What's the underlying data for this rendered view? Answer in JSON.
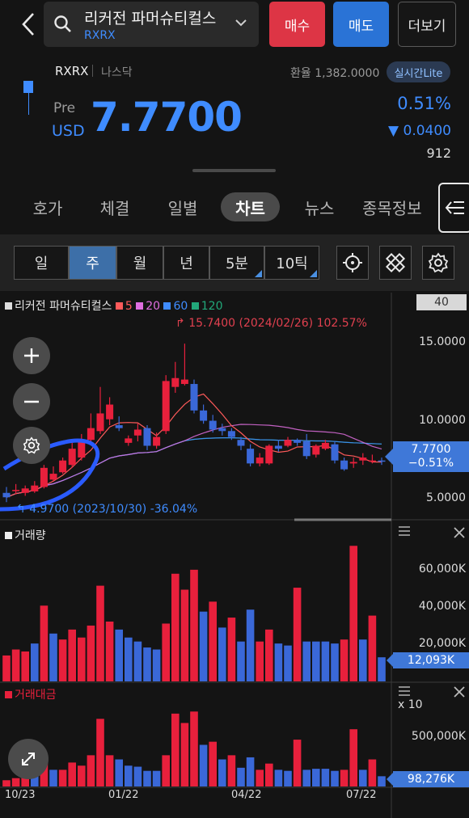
{
  "header": {
    "stock_name": "리커전 파머슈티컬스",
    "ticker": "RXRX",
    "buy_label": "매수",
    "sell_label": "매도",
    "more_label": "더보기"
  },
  "info": {
    "ticker": "RXRX",
    "market": "나스닥",
    "exchange_rate": "환율 1,382.0000",
    "realtime_label": "실시간Lite",
    "pre_label": "Pre",
    "currency": "USD",
    "price": "7.7700",
    "change_pct": "0.51%",
    "change_amount": "▼ 0.0400",
    "volume": "912"
  },
  "tabs": [
    {
      "label": "호가"
    },
    {
      "label": "체결"
    },
    {
      "label": "일별"
    },
    {
      "label": "차트",
      "active": true
    },
    {
      "label": "뉴스"
    },
    {
      "label": "종목정보"
    }
  ],
  "periods": [
    {
      "label": "일"
    },
    {
      "label": "주",
      "active": true
    },
    {
      "label": "월"
    },
    {
      "label": "년"
    },
    {
      "label": "5분"
    },
    {
      "label": "10틱"
    }
  ],
  "legend": {
    "name": "리커전 파머슈티컬스",
    "ma": [
      {
        "label": "5",
        "color": "#ff5a5a"
      },
      {
        "label": "20",
        "color": "#e06ee0"
      },
      {
        "label": "60",
        "color": "#3f8cff"
      },
      {
        "label": "120",
        "color": "#22a87a"
      }
    ]
  },
  "price_panel": {
    "y_header": "40",
    "y_ticks": [
      "15.0000",
      "10.0000",
      "5.0000"
    ],
    "current_price": "7.7700",
    "current_change": "−0.51%",
    "high_annotation": "15.7400 (2024/02/26) 102.57%",
    "low_annotation": "4.9700 (2023/10/30) -36.04%"
  },
  "volume_panel": {
    "label": "거래량",
    "y_ticks": [
      "60,000K",
      "40,000K",
      "20,000K"
    ],
    "current": "12,093K"
  },
  "amount_panel": {
    "label": "거래대금",
    "multiplier": "x 10",
    "y_ticks": [
      "500,000K"
    ],
    "current": "98,276K"
  },
  "x_labels": [
    "10/23",
    "01/22",
    "04/22",
    "07/22"
  ],
  "colors": {
    "up": "#e8203c",
    "down": "#3a68d8",
    "accent": "#3f8cff"
  },
  "chart_data": {
    "type": "candlestick",
    "x": [
      "2023-10-16",
      "2023-10-23",
      "2023-10-30",
      "2023-11-06",
      "2023-11-13",
      "2023-11-20",
      "2023-11-27",
      "2023-12-04",
      "2023-12-11",
      "2023-12-18",
      "2023-12-25",
      "2024-01-01",
      "2024-01-08",
      "2024-01-15",
      "2024-01-22",
      "2024-01-29",
      "2024-02-05",
      "2024-02-12",
      "2024-02-19",
      "2024-02-26",
      "2024-03-04",
      "2024-03-11",
      "2024-03-18",
      "2024-03-25",
      "2024-04-01",
      "2024-04-08",
      "2024-04-15",
      "2024-04-22",
      "2024-04-29",
      "2024-05-06",
      "2024-05-13",
      "2024-05-20",
      "2024-05-27",
      "2024-06-03",
      "2024-06-10",
      "2024-06-17",
      "2024-06-24",
      "2024-07-01",
      "2024-07-08",
      "2024-07-15",
      "2024-07-22"
    ],
    "series": [
      {
        "name": "리커전 파머슈티컬스",
        "open": [
          5.6,
          5.8,
          5.6,
          5.7,
          6.0,
          6.5,
          7.0,
          7.5,
          8.0,
          9.2,
          9.8,
          10.6,
          10.2,
          9.0,
          9.5,
          10.0,
          8.8,
          9.8,
          12.8,
          13.0,
          13.0,
          11.2,
          10.5,
          10.0,
          9.8,
          9.2,
          8.6,
          7.6,
          7.6,
          8.8,
          8.8,
          9.2,
          9.1,
          8.2,
          8.6,
          8.9,
          7.8,
          7.6,
          7.8,
          7.8,
          7.8
        ],
        "close": [
          5.3,
          5.8,
          5.9,
          6.1,
          7.3,
          6.9,
          7.8,
          8.6,
          9.2,
          10.0,
          11.0,
          11.6,
          10.0,
          9.3,
          9.9,
          8.8,
          9.4,
          13.2,
          13.4,
          13.3,
          11.2,
          10.5,
          9.9,
          9.8,
          9.4,
          8.8,
          7.6,
          8.0,
          8.8,
          8.6,
          9.2,
          9.0,
          8.1,
          8.8,
          9.0,
          7.8,
          7.2,
          7.7,
          8.0,
          7.8,
          7.77
        ],
        "high": [
          6.0,
          6.2,
          6.1,
          6.4,
          7.5,
          7.4,
          8.0,
          9.0,
          9.6,
          11.0,
          12.8,
          12.1,
          10.8,
          9.5,
          10.3,
          10.2,
          9.7,
          13.6,
          14.5,
          15.74,
          13.3,
          11.6,
          10.9,
          10.3,
          10.0,
          9.4,
          8.9,
          8.3,
          8.9,
          9.2,
          9.4,
          9.3,
          9.6,
          8.9,
          9.2,
          9.1,
          8.0,
          8.0,
          8.3,
          8.2,
          8.0
        ],
        "low": [
          4.97,
          5.5,
          5.4,
          5.6,
          5.9,
          6.4,
          6.9,
          7.3,
          7.8,
          9.0,
          9.6,
          10.2,
          9.8,
          8.8,
          9.1,
          8.5,
          8.6,
          9.6,
          12.4,
          12.9,
          11.0,
          10.3,
          9.7,
          9.5,
          9.2,
          8.5,
          7.4,
          7.4,
          7.5,
          8.4,
          8.7,
          8.8,
          7.9,
          8.0,
          8.5,
          7.6,
          7.1,
          7.3,
          7.5,
          7.6,
          7.5
        ]
      }
    ],
    "volume_k": [
      13000,
      16000,
      15000,
      19000,
      38000,
      24000,
      21000,
      26000,
      22000,
      28000,
      48000,
      30000,
      26000,
      22000,
      20000,
      17000,
      16000,
      29000,
      54000,
      46000,
      56000,
      35000,
      40000,
      27000,
      32000,
      20000,
      36000,
      20000,
      26000,
      19000,
      18000,
      47000,
      20000,
      20000,
      20000,
      19000,
      21000,
      68000,
      21000,
      33000,
      12093
    ],
    "volume_colors": [
      "up",
      "up",
      "up",
      "down",
      "up",
      "down",
      "up",
      "up",
      "up",
      "up",
      "up",
      "up",
      "down",
      "down",
      "down",
      "down",
      "down",
      "up",
      "up",
      "up",
      "up",
      "down",
      "up",
      "down",
      "up",
      "down",
      "down",
      "up",
      "up",
      "down",
      "down",
      "up",
      "down",
      "down",
      "down",
      "down",
      "up",
      "up",
      "down",
      "up",
      "down"
    ],
    "amount_x10_k": [
      60000,
      80000,
      90000,
      100000,
      280000,
      160000,
      160000,
      230000,
      200000,
      300000,
      650000,
      300000,
      260000,
      200000,
      190000,
      150000,
      150000,
      300000,
      700000,
      610000,
      720000,
      400000,
      430000,
      260000,
      300000,
      180000,
      280000,
      160000,
      220000,
      160000,
      150000,
      450000,
      160000,
      170000,
      170000,
      150000,
      160000,
      550000,
      160000,
      260000,
      98276
    ],
    "y_axis_price": [
      3.5,
      18
    ],
    "y_axis_volume_k": [
      0,
      75000
    ],
    "y_axis_amount_x10_k": [
      0,
      800000
    ],
    "grid": false
  }
}
